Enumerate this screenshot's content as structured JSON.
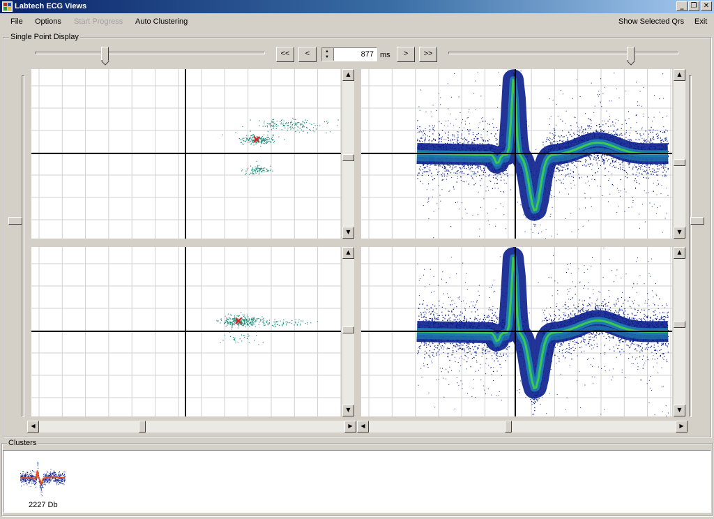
{
  "window": {
    "title": "Labtech ECG Views"
  },
  "menu": {
    "file": "File",
    "options": "Options",
    "start_progress": "Start Progress",
    "auto_clustering": "Auto Clustering",
    "show_selected": "Show Selected Qrs",
    "exit": "Exit"
  },
  "single_point": {
    "label": "Single Point Display",
    "btn_first": "<<",
    "btn_prev": "<",
    "time_value": "877",
    "time_unit": "ms",
    "btn_next": ">",
    "btn_last": ">>"
  },
  "clusters": {
    "label": "Clusters",
    "items": [
      {
        "label": "2227 Db"
      }
    ]
  },
  "colors": {
    "scatter_green": "#1e8c78",
    "marker_red": "#e02020",
    "density_low": "#0a1e8c",
    "density_mid": "#1e8cb4",
    "density_high": "#3cc850",
    "cluster_trace": "#e85020"
  }
}
